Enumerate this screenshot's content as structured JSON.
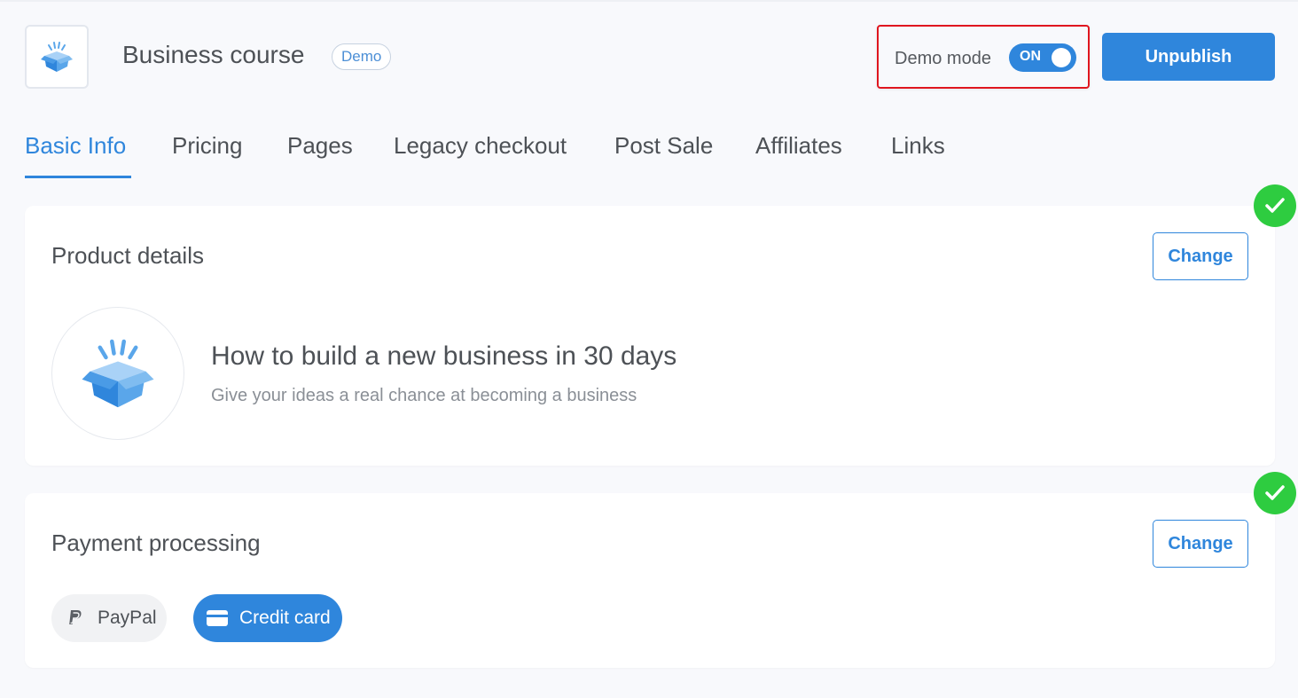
{
  "header": {
    "title": "Business course",
    "badge": "Demo",
    "demo_mode_label": "Demo mode",
    "toggle_state": "ON",
    "unpublish_label": "Unpublish"
  },
  "tabs": [
    {
      "label": "Basic Info",
      "active": true
    },
    {
      "label": "Pricing"
    },
    {
      "label": "Pages"
    },
    {
      "label": "Legacy checkout"
    },
    {
      "label": "Post Sale"
    },
    {
      "label": "Affiliates"
    },
    {
      "label": "Links"
    }
  ],
  "product_details": {
    "title": "Product details",
    "change_label": "Change",
    "product_name": "How to build a new business in 30 days",
    "product_description": "Give your ideas a real chance at becoming a business",
    "complete": true
  },
  "payment_processing": {
    "title": "Payment processing",
    "change_label": "Change",
    "methods": [
      {
        "label": "PayPal",
        "icon": "paypal-icon",
        "selected": false
      },
      {
        "label": "Credit card",
        "icon": "credit-card-icon",
        "selected": true
      }
    ],
    "complete": true
  },
  "colors": {
    "accent": "#2f86dc",
    "success": "#2ecc40",
    "highlight_border": "#e0161f"
  }
}
